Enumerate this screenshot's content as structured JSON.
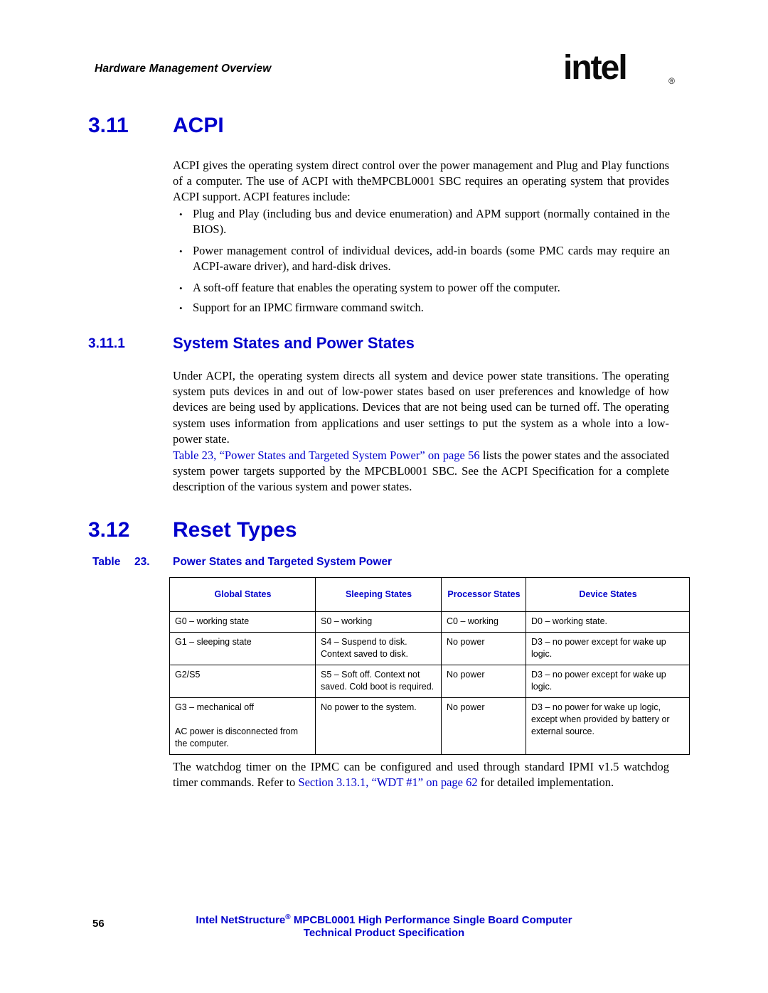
{
  "header": {
    "running_title": "Hardware Management Overview",
    "logo_text": "intel",
    "logo_mark": "®"
  },
  "sections": {
    "acpi": {
      "number": "3.11",
      "title": "ACPI",
      "intro": "ACPI gives the operating system direct control over the power management and Plug and Play functions of a computer. The use of ACPI with theMPCBL0001 SBC requires an operating system that provides ACPI support. ACPI features include:",
      "bullets": [
        "Plug and Play (including bus and device enumeration) and APM support (normally contained in the BIOS).",
        "Power management control of individual devices, add-in boards (some PMC cards may require an ACPI-aware driver), and hard-disk drives.",
        "A soft-off feature that enables the operating system to power off the computer.",
        "Support for an IPMC firmware command switch."
      ]
    },
    "system_states": {
      "number": "3.11.1",
      "title": "System States and Power States",
      "para1": "Under ACPI, the operating system directs all system and device power state transitions. The operating system puts devices in and out of low-power states based on user preferences and knowledge of how devices are being used by applications. Devices that are not being used can be turned off. The operating system uses information from applications and user settings to put the system as a whole into a low-power state.",
      "para2_link": "Table 23, “Power States and Targeted System Power” on page 56",
      "para2_rest": " lists the power states and the associated system power targets supported by the MPCBL0001 SBC. See the ACPI Specification for a complete description of the various system and power states."
    },
    "reset_types": {
      "number": "3.12",
      "title": "Reset Types"
    }
  },
  "table": {
    "caption_label": "Table",
    "caption_number": "23.",
    "caption_title": "Power States and Targeted System Power",
    "headers": [
      "Global States",
      "Sleeping States",
      "Processor States",
      "Device States"
    ],
    "rows": [
      [
        "G0 – working state",
        "S0 – working",
        "C0 – working",
        "D0 – working state."
      ],
      [
        "G1 – sleeping state",
        "S4 – Suspend to disk. Context saved to disk.",
        "No power",
        "D3 – no power except for wake up logic."
      ],
      [
        "G2/S5",
        "S5 – Soft off. Context not saved. Cold boot is required.",
        "No power",
        "D3 – no power except for wake up logic."
      ],
      [
        "G3 – mechanical off\n\nAC power is disconnected from the computer.",
        "No power to the system.",
        "No power",
        "D3 – no power for wake up logic, except when provided by battery or external source."
      ]
    ]
  },
  "closing": {
    "text_before": "The watchdog timer on the IPMC can be configured and used through standard IPMI v1.5 watchdog timer commands. Refer to ",
    "link": "Section 3.13.1, “WDT #1” on page 62",
    "text_after": " for detailed implementation."
  },
  "footer": {
    "page_number": "56",
    "line1_part1": "Intel NetStructure",
    "line1_sup": "®",
    "line1_part2": " MPCBL0001 High Performance Single Board Computer",
    "line2": "Technical Product Specification"
  },
  "colors": {
    "heading_blue": "#0000CC",
    "text_black": "#000000",
    "background": "#FFFFFF"
  }
}
